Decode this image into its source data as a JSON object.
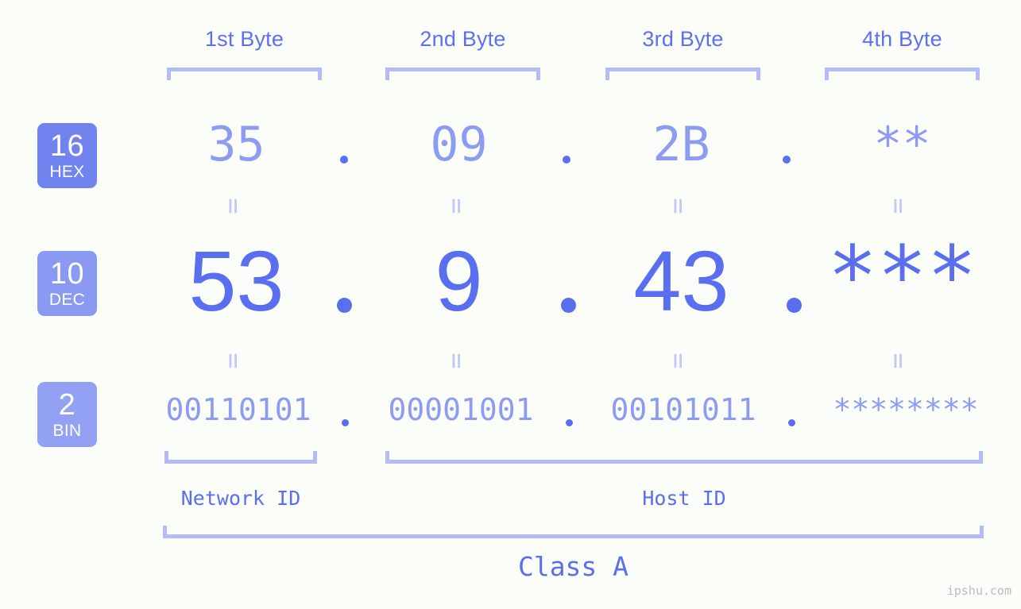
{
  "colors": {
    "background": "#fbfdf8",
    "accent_strong": "#5a6ef0",
    "accent_mid": "#8d9bf3",
    "accent_light": "#b4bcf7",
    "badge_hex": "#7083ee",
    "badge_dec": "#8a99f2",
    "badge_bin": "#93a1f4",
    "watermark": "#b9bcc0"
  },
  "byte_headers": [
    {
      "label": "1st Byte"
    },
    {
      "label": "2nd Byte"
    },
    {
      "label": "3rd Byte"
    },
    {
      "label": "4th Byte"
    }
  ],
  "bases": [
    {
      "number": "16",
      "name": "HEX"
    },
    {
      "number": "10",
      "name": "DEC"
    },
    {
      "number": "2",
      "name": "BIN"
    }
  ],
  "rows": {
    "hex": {
      "bytes": [
        "35",
        "09",
        "2B",
        "**"
      ],
      "separators": [
        ".",
        ".",
        "."
      ]
    },
    "dec": {
      "bytes": [
        "53",
        "9",
        "43",
        "***"
      ],
      "separators": [
        ".",
        ".",
        "."
      ]
    },
    "bin": {
      "bytes": [
        "00110101",
        "00001001",
        "00101011",
        "********"
      ],
      "separators": [
        ".",
        ".",
        "."
      ]
    }
  },
  "equals": {
    "glyph": "=",
    "hex_to_dec": [
      "=",
      "=",
      "=",
      "="
    ],
    "dec_to_bin": [
      "=",
      "=",
      "=",
      "="
    ]
  },
  "segments": {
    "network_id": "Network ID",
    "host_id": "Host ID",
    "class": "Class A"
  },
  "watermark": "ipshu.com"
}
